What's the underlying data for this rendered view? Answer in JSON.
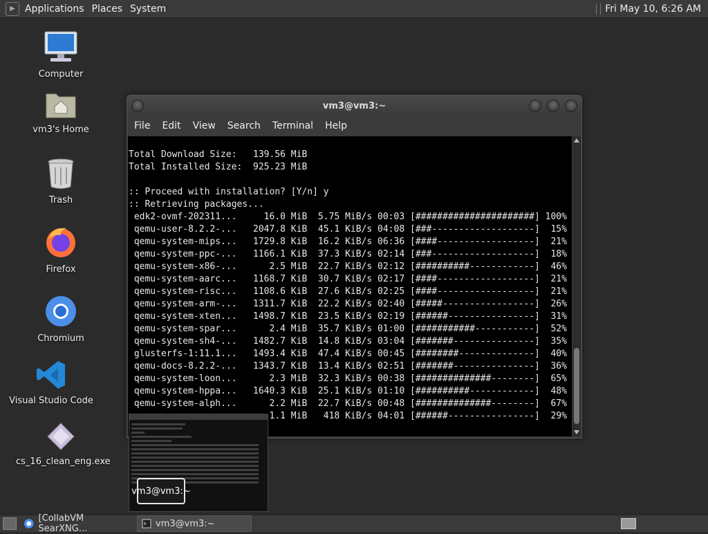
{
  "top_panel": {
    "menus": [
      "Applications",
      "Places",
      "System"
    ],
    "clock": "Fri May 10,  6:26 AM"
  },
  "desktop": {
    "icons": [
      {
        "label": "Computer",
        "icon": "computer-icon"
      },
      {
        "label": "vm3's Home",
        "icon": "home-folder-icon"
      },
      {
        "label": "Trash",
        "icon": "trash-icon"
      },
      {
        "label": "Firefox",
        "icon": "firefox-icon"
      },
      {
        "label": "Chromium",
        "icon": "chromium-icon"
      },
      {
        "label": "Visual Studio Code",
        "icon": "vscode-icon"
      },
      {
        "label": "cs_16_clean_eng.exe",
        "icon": "exe-file-icon"
      }
    ]
  },
  "terminal": {
    "title": "vm3@vm3:~",
    "menus": [
      "File",
      "Edit",
      "View",
      "Search",
      "Terminal",
      "Help"
    ],
    "lines": [
      "",
      "Total Download Size:   139.56 MiB",
      "Total Installed Size:  925.23 MiB",
      "",
      ":: Proceed with installation? [Y/n] y",
      ":: Retrieving packages...",
      " edk2-ovmf-202311...     16.0 MiB  5.75 MiB/s 00:03 [######################] 100%",
      " qemu-user-8.2.2-...   2047.8 KiB  45.1 KiB/s 04:08 [###-------------------]  15%",
      " qemu-system-mips...   1729.8 KiB  16.2 KiB/s 06:36 [####------------------]  21%",
      " qemu-system-ppc-...   1166.1 KiB  37.3 KiB/s 02:14 [###-------------------]  18%",
      " qemu-system-x86-...      2.5 MiB  22.7 KiB/s 02:12 [##########------------]  46%",
      " qemu-system-aarc...   1168.7 KiB  30.7 KiB/s 02:17 [####------------------]  21%",
      " qemu-system-risc...   1108.6 KiB  27.6 KiB/s 02:25 [####------------------]  21%",
      " qemu-system-arm-...   1311.7 KiB  22.2 KiB/s 02:40 [#####-----------------]  26%",
      " qemu-system-xten...   1498.7 KiB  23.5 KiB/s 02:19 [######----------------]  31%",
      " qemu-system-spar...      2.4 MiB  35.7 KiB/s 01:00 [###########-----------]  52%",
      " qemu-system-sh4-...   1482.7 KiB  14.8 KiB/s 03:04 [#######---------------]  35%",
      " glusterfs-1:11.1...   1493.4 KiB  47.4 KiB/s 00:45 [########--------------]  40%",
      " qemu-docs-8.2.2-...   1343.7 KiB  13.4 KiB/s 02:51 [#######---------------]  36%",
      " qemu-system-loon...      2.3 MiB  32.3 KiB/s 00:38 [##############--------]  65%",
      " qemu-system-hppa...   1640.3 KiB  25.1 KiB/s 01:10 [##########------------]  48%",
      " qemu-system-alph...      2.2 MiB  22.7 KiB/s 00:48 [##############--------]  67%",
      "                          1.1 MiB   418 KiB/s 04:01 [######----------------]  29%"
    ]
  },
  "preview": {
    "label": "vm3@vm3:~"
  },
  "taskbar": {
    "tasks": [
      {
        "label": "[CollabVM SearXNG...",
        "icon": "chromium-icon"
      },
      {
        "label": "vm3@vm3:~",
        "icon": "terminal-icon"
      }
    ]
  }
}
